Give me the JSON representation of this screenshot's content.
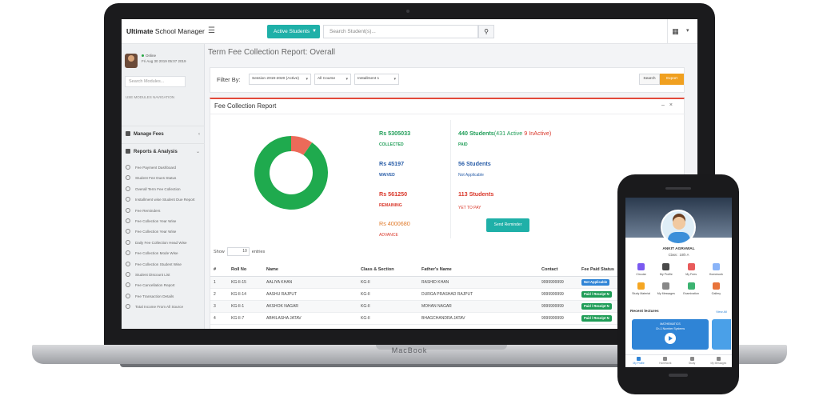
{
  "app": {
    "brand_bold": "Ultimate",
    "brand_rest": " School Manager",
    "active_students_label": "Active Students",
    "search_placeholder": "Search Student(s)...",
    "laptop_brand": "MacBook"
  },
  "sidebar": {
    "status": "Online",
    "last_login": "Fri Aug 30 2019 05:07 2019",
    "search_placeholder": "Search Modules...",
    "caption": "USE MODULES NAVIGATION",
    "sections": [
      {
        "label": "Manage Fees"
      },
      {
        "label": "Reports & Analysis"
      }
    ],
    "items": [
      "Fee Payment Dashboard",
      "Student Fee Dues Status",
      "Overall Term Fee Collection",
      "Installment wise Student Due Report",
      "Fee Reminders",
      "Fee Collection Year Wise",
      "Fee Collection Year Wise",
      "Daily Fee Collection Head Wise",
      "Fee Collection Mode Wise",
      "Fee Collection Student Wise",
      "Student Discount List",
      "Fee Cancellation Report",
      "Fee Transaction Details",
      "Total Income From All Source"
    ]
  },
  "page": {
    "title": "Term Fee Collection Report: Overall",
    "filter_label": "Filter By:",
    "filters": {
      "session": "Session 2019-2020 (Active)",
      "course": "All Course",
      "installment": "Installment 1"
    },
    "search_btn": "Search",
    "export_btn": "Export"
  },
  "report": {
    "title": "Fee Collection Report",
    "collected": {
      "value": "Rs 5305033",
      "label": "COLLECTED"
    },
    "waived": {
      "value": "Rs 45197",
      "label": "WAIVED"
    },
    "remaining": {
      "value": "Rs 561250",
      "label": "REMAINING"
    },
    "advance": {
      "value": "Rs 4000680",
      "label": "ADVANCE"
    },
    "paid_students": {
      "count": "440 Students",
      "active": "(431 Active",
      "inactive": " 9 InActive)",
      "label": "PAID"
    },
    "na_students": {
      "value": "56 Students",
      "label": "Not Applicable"
    },
    "yet_students": {
      "value": "113 Students",
      "label": "YET TO PAY"
    },
    "reminder_btn": "Send Reminder",
    "show_label": "Show",
    "show_value": "10",
    "entries_label": "entries"
  },
  "table": {
    "headers": [
      "#",
      "Roll No",
      "Name",
      "Class & Section",
      "Father's Name",
      "Contact",
      "Fee Paid Status"
    ],
    "rows": [
      {
        "idx": "1",
        "roll": "KG-II-15",
        "name": "AALIYA KHAN",
        "class": "KG-II",
        "father": "RASHID KHAN",
        "contact": "9999999999",
        "status": "Not Applicable"
      },
      {
        "idx": "2",
        "roll": "KG-II-14",
        "name": "AASHU RAJPUT",
        "class": "KG-II",
        "father": "DURGA PRASHAD RAJPUT",
        "contact": "9999999999",
        "status": "Paid / Receipt N"
      },
      {
        "idx": "3",
        "roll": "KG-II-1",
        "name": "AKSHOK NAGAR",
        "class": "KG-II",
        "father": "MOHAN NAGAR",
        "contact": "9999999999",
        "status": "Paid / Receipt N"
      },
      {
        "idx": "4",
        "roll": "KG-II-7",
        "name": "ABHILASHA JATAV",
        "class": "KG-II",
        "father": "BHAGCHANDRA JATAV",
        "contact": "9999999999",
        "status": "Paid / Receipt N"
      }
    ]
  },
  "chart_data": {
    "type": "pie",
    "categories": [
      "Collected",
      "Remaining"
    ],
    "values": [
      90.4,
      9.6
    ],
    "colors": [
      "#1faa4e",
      "#ec6a59"
    ]
  },
  "phone": {
    "student_name": "ANKIT AGRAWAL",
    "student_class": "Class : 10th A",
    "menu": [
      {
        "label": "Circular",
        "icon": "circular-icon",
        "color": "#7a5af0"
      },
      {
        "label": "My Profile",
        "icon": "profile-icon",
        "color": "#4a4a4a"
      },
      {
        "label": "My Fees",
        "icon": "fees-icon",
        "color": "#e85b5b"
      },
      {
        "label": "Homework",
        "icon": "homework-icon",
        "color": "#8ab4f8"
      },
      {
        "label": "Study Material",
        "icon": "study-material-icon",
        "color": "#f5a623"
      },
      {
        "label": "My Messages",
        "icon": "messages-icon",
        "color": "#888888"
      },
      {
        "label": "Examination",
        "icon": "examination-icon",
        "color": "#3cb371"
      },
      {
        "label": "Gallery",
        "icon": "gallery-icon",
        "color": "#e8743b"
      }
    ],
    "recent_title": "Recent lectures",
    "view_all": "View All",
    "lecture_line1": "MATHEMATICS",
    "lecture_line2": "Ch-1 Number Systems",
    "tabs": [
      {
        "label": "My Profile"
      },
      {
        "label": "Homework"
      },
      {
        "label": "Study"
      },
      {
        "label": "My Messages"
      }
    ]
  }
}
